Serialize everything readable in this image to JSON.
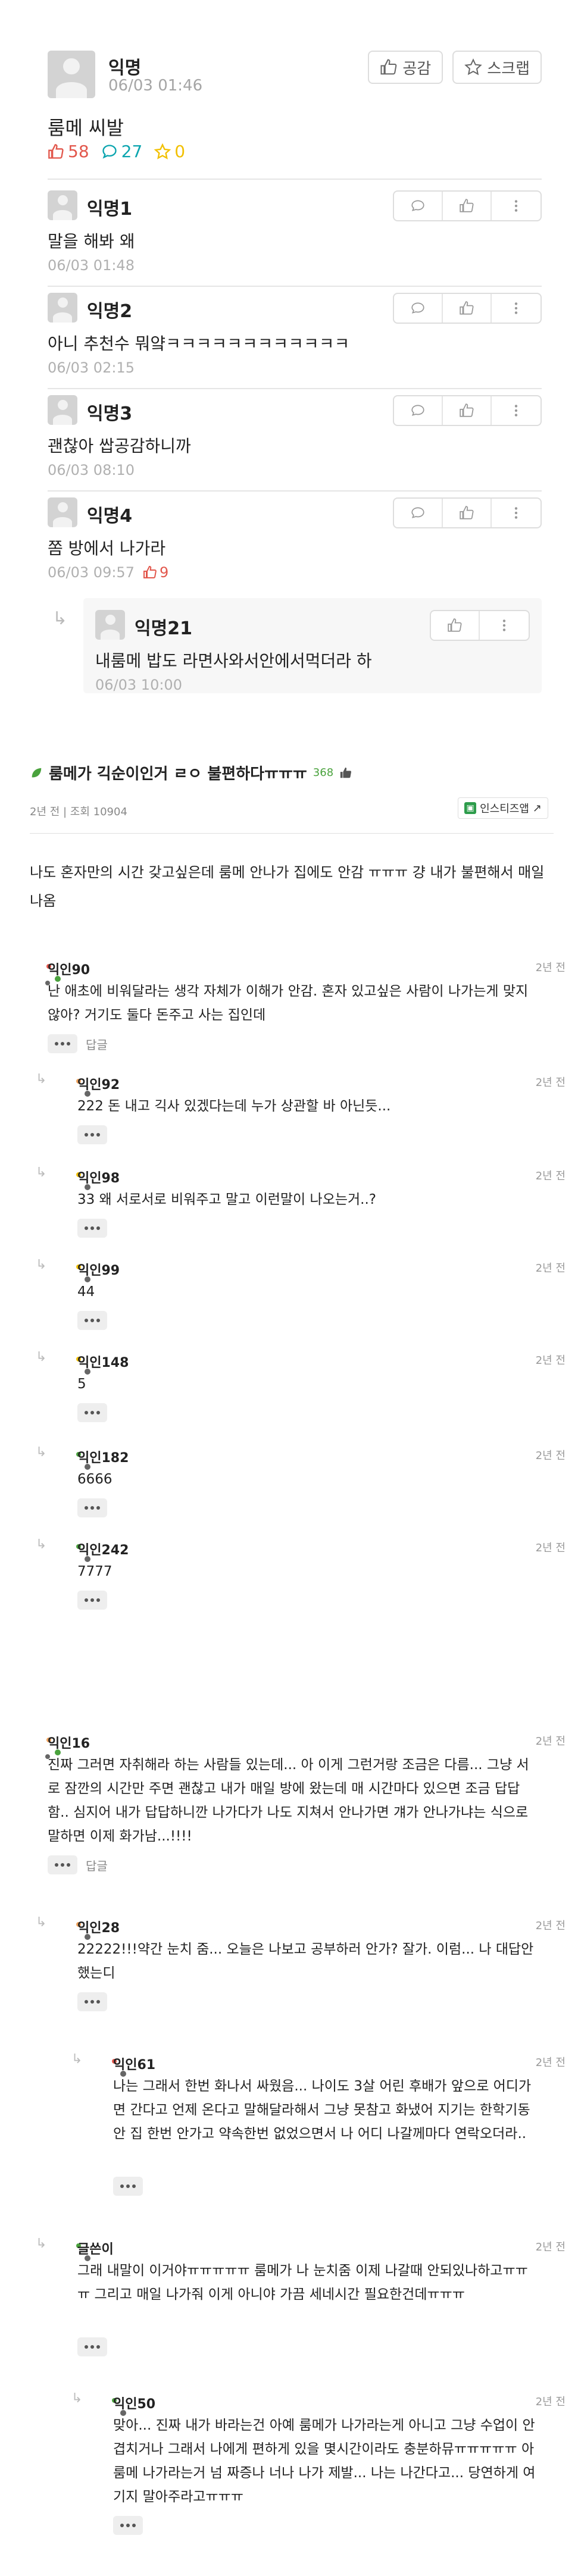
{
  "post": {
    "author": "익명",
    "time": "06/03 01:46",
    "content": "룸메 씨발",
    "likes": "58",
    "comments": "27",
    "scraps": "0",
    "like_button": "공감",
    "scrap_button": "스크랩"
  },
  "comments": [
    {
      "author": "익명1",
      "text": "말을 해봐 왜",
      "time": "06/03 01:48",
      "likes": ""
    },
    {
      "author": "익명2",
      "text": "아니 추천수 뭐얔ㅋㅋㅋㅋㅋㅋㅋㅋㅋㅋㅋㅋ",
      "time": "06/03 02:15",
      "likes": ""
    },
    {
      "author": "익명3",
      "text": "괜찮아 쌉공감하니까",
      "time": "06/03 08:10",
      "likes": ""
    },
    {
      "author": "익명4",
      "text": "쫌 방에서 나가라",
      "time": "06/03 09:57",
      "likes": "9"
    }
  ],
  "reply": {
    "author": "익명21",
    "text": "내룸메 밥도 라면사와서안에서먹더라 하",
    "time": "06/03 10:00"
  },
  "thread": {
    "title": "룸메가 긱순이인거 ㄹㅇ 불편하다ㅠㅠㅠ",
    "count": "368",
    "meta": "2년 전 | 조회 10904",
    "instiz_button": "인스티즈앱",
    "body": "나도 혼자만의 시간 갖고싶은데 룸메 안나가 집에도 안감 ㅠㅠㅠ 걍 내가 불편해서 매일 나옴"
  },
  "instiz_comments": [
    {
      "name": "익인90",
      "when": "2년 전",
      "text": "난 애초에 비워달라는 생각 자체가 이해가 안감. 혼자 있고싶은 사람이 나가는게 맞지 않아? 거기도 둘다 돈주고 사는 집인데",
      "reply_label": "답글"
    },
    {
      "name": "익인92",
      "when": "2년 전",
      "text": "222 돈 내고 긱사 있겠다는데 누가 상관할 바 아닌듯..."
    },
    {
      "name": "익인98",
      "when": "2년 전",
      "text": "33 왜 서로서로 비워주고 말고 이런말이 나오는거..?"
    },
    {
      "name": "익인99",
      "when": "2년 전",
      "text": "44"
    },
    {
      "name": "익인148",
      "when": "2년 전",
      "text": "5"
    },
    {
      "name": "익인182",
      "when": "2년 전",
      "text": "6666"
    },
    {
      "name": "익인242",
      "when": "2년 전",
      "text": "7777"
    },
    {
      "name": "익인16",
      "when": "2년 전",
      "text": "진짜 그러면 자취해라 하는 사람들 있는데... 아 이게 그런거랑 조금은 다름... 그냥 서로 잠깐의 시간만 주면 괜찮고 내가 매일 방에 왔는데 매 시간마다 있으면 조금 답답함.. 심지어 내가 답답하니깐 나가다가 나도 지쳐서 안나가면 걔가 안나가냐는 식으로 말하면 이제 화가남...!!!!",
      "reply_label": "답글"
    },
    {
      "name": "익인28",
      "when": "2년 전",
      "text": "22222!!!약간 눈치 줌... 오늘은 나보고 공부하러 안가? 잘가. 이럼... 나 대답안했는디"
    },
    {
      "name": "익인61",
      "when": "2년 전",
      "text": "나는 그래서 한번 화나서 싸웠음... 나이도 3살 어린 후배가 앞으로 어디가면 간다고 언제 온다고 말해달라해서 그냥 못참고 화냈어 지기는 한학기동안 집 한번 안가고 약속한번 없었으면서 나 어디 나갈께마다 연락오더라.."
    },
    {
      "name": "글쓴이",
      "when": "2년 전",
      "text": "그래 내말이 이거야ㅠㅠㅠㅠㅠ 룸메가 나 눈치줌 이제 나갈때 안되있나하고ㅠㅠㅠ 그리고 매일 나가줘 이게 아니야 가끔 세네시간 필요한건데ㅠㅠㅠ"
    },
    {
      "name": "익인50",
      "when": "2년 전",
      "text": "맞아... 진짜 내가 바라는건 아예 룸메가 나가라는게 아니고 그냥 수업이 안겹치거나 그래서 나에게 편하게 있을 몇시간이라도 충분하뮤ㅠㅠㅠㅠㅠ 아 룸메 나가라는거 넘 짜증나 너나 나가 제발... 나는 나간다고... 당연하게 여기지 말아주라고ㅠㅠㅠ"
    }
  ],
  "colors": {
    "accent_red": "#e2574c",
    "accent_teal": "#0ca5af",
    "accent_yellow": "#f2c000",
    "instiz_green": "#2d9c4b"
  }
}
